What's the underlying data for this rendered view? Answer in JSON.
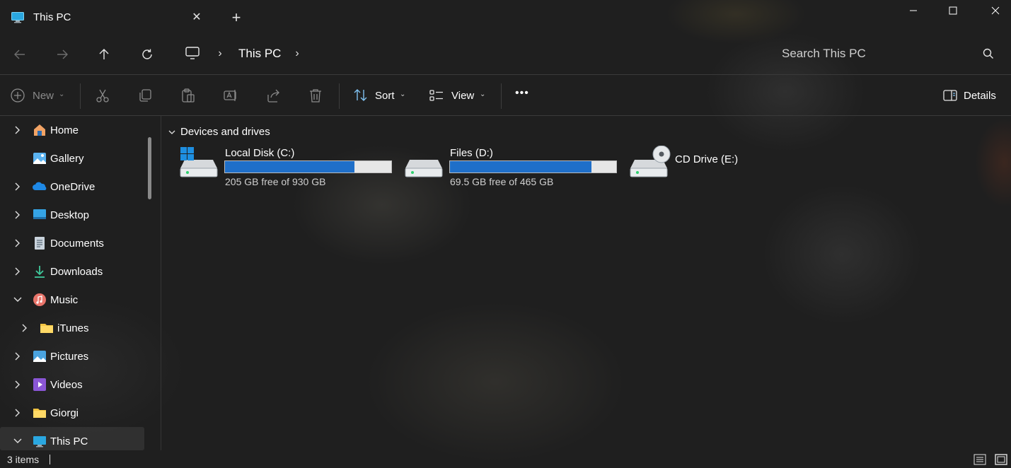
{
  "window": {
    "tab_title": "This PC",
    "new_tab_symbol": "+",
    "close_tab_symbol": "✕"
  },
  "address": {
    "location_icon": "this-pc-icon",
    "crumb_label": "This PC",
    "separator": "›",
    "search_placeholder": "Search This PC"
  },
  "toolbar": {
    "new_label": "New",
    "sort_label": "Sort",
    "view_label": "View",
    "details_label": "Details",
    "more_symbol": "•••",
    "dropdown_symbol": "⌄"
  },
  "sidebar": {
    "items": [
      {
        "label": "Home",
        "icon": "home-icon",
        "chevron": "right"
      },
      {
        "label": "Gallery",
        "icon": "gallery-icon",
        "chevron": "none"
      },
      {
        "label": "OneDrive",
        "icon": "onedrive-icon",
        "chevron": "right"
      },
      {
        "label": "Desktop",
        "icon": "desktop-icon",
        "chevron": "right"
      },
      {
        "label": "Documents",
        "icon": "documents-icon",
        "chevron": "right"
      },
      {
        "label": "Downloads",
        "icon": "downloads-icon",
        "chevron": "right"
      },
      {
        "label": "Music",
        "icon": "music-icon",
        "chevron": "down"
      },
      {
        "label": "iTunes",
        "icon": "folder-icon",
        "chevron": "right"
      },
      {
        "label": "Pictures",
        "icon": "pictures-icon",
        "chevron": "right"
      },
      {
        "label": "Videos",
        "icon": "videos-icon",
        "chevron": "right"
      },
      {
        "label": "Giorgi",
        "icon": "folder-icon",
        "chevron": "right"
      },
      {
        "label": "This PC",
        "icon": "this-pc-icon",
        "chevron": "down"
      }
    ]
  },
  "content": {
    "group_title": "Devices and drives",
    "drives": [
      {
        "name": "Local Disk (C:)",
        "free_text": "205 GB free of 930 GB",
        "used_fraction": 0.78
      },
      {
        "name": "Files (D:)",
        "free_text": "69.5 GB free of 465 GB",
        "used_fraction": 0.85
      },
      {
        "name": "CD Drive (E:)"
      }
    ]
  },
  "status": {
    "item_count": "3 items"
  },
  "colors": {
    "accent": "#1f6fc9",
    "background": "#1f1f1f",
    "folder": "#f4c542"
  }
}
